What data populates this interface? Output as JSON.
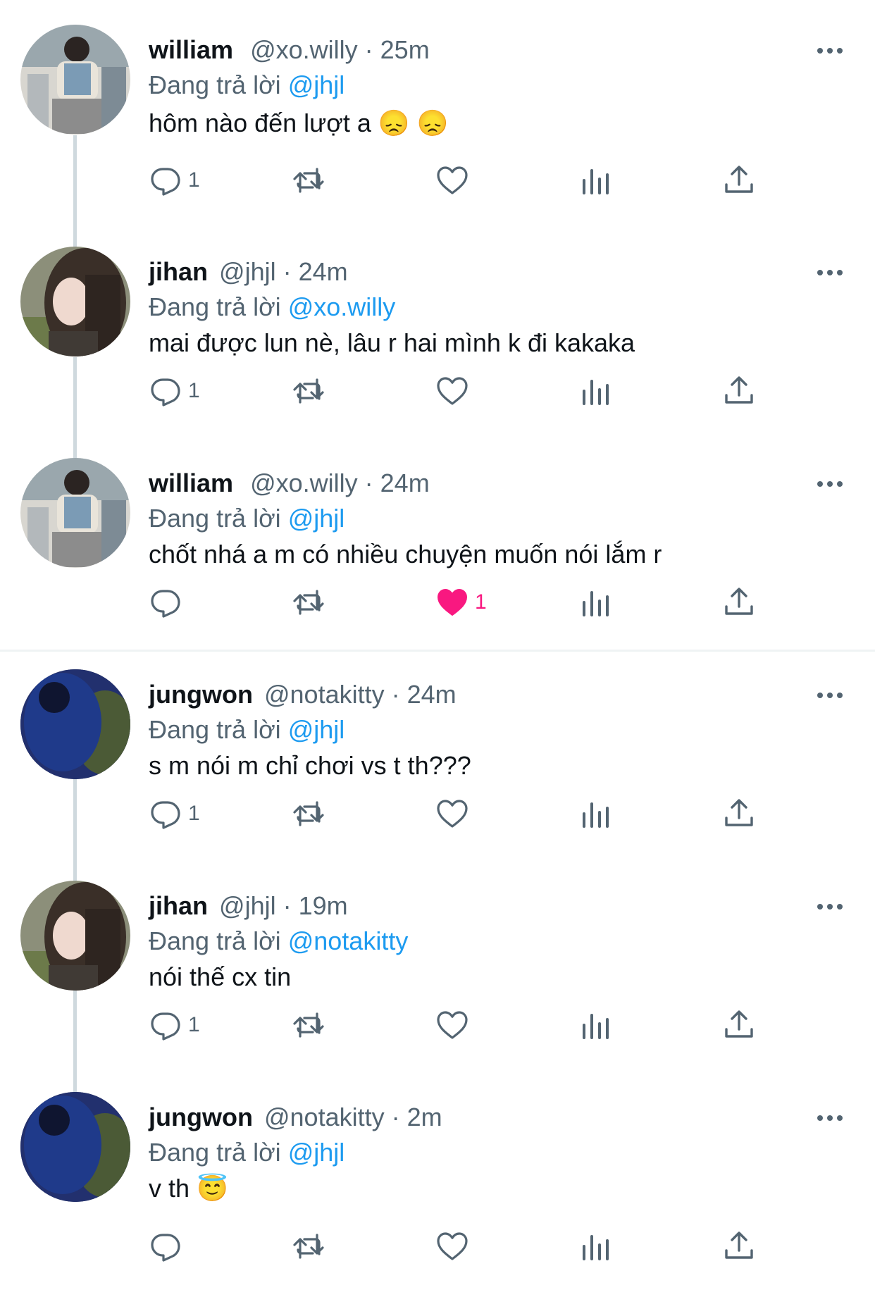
{
  "reply_prefix": "Đang trả lời",
  "tweets": [
    {
      "name": "william",
      "handle": "@xo.willy",
      "dot": "·",
      "time": "25m",
      "reply_to": "@jhjl",
      "text": "hôm nào đến lượt a 😞 😞",
      "reply_count": "1",
      "like_count": "",
      "liked": false
    },
    {
      "name": "jihan",
      "handle": "@jhjl",
      "dot": "·",
      "time": "24m",
      "reply_to": "@xo.willy",
      "text": "mai được lun nè, lâu r hai mình k đi kakaka",
      "reply_count": "1",
      "like_count": "",
      "liked": false
    },
    {
      "name": "william",
      "handle": "@xo.willy",
      "dot": "·",
      "time": "24m",
      "reply_to": "@jhjl",
      "text": "chốt nhá a m có nhiều chuyện muốn nói lắm r",
      "reply_count": "",
      "like_count": "1",
      "liked": true
    },
    {
      "name": "jungwon",
      "handle": "@notakitty",
      "dot": "·",
      "time": "24m",
      "reply_to": "@jhjl",
      "text": "s m nói m chỉ chơi vs t th???",
      "reply_count": "1",
      "like_count": "",
      "liked": false
    },
    {
      "name": "jihan",
      "handle": "@jhjl",
      "dot": "·",
      "time": "19m",
      "reply_to": "@notakitty",
      "text": "nói thế cx tin",
      "reply_count": "1",
      "like_count": "",
      "liked": false
    },
    {
      "name": "jungwon",
      "handle": "@notakitty",
      "dot": "·",
      "time": "2m",
      "reply_to": "@jhjl",
      "text": "v th 😇",
      "reply_count": "",
      "like_count": "",
      "liked": false
    }
  ],
  "colors": {
    "accent": "#1d9bf0",
    "like": "#f91880",
    "muted": "#536471",
    "text": "#0f1419"
  }
}
